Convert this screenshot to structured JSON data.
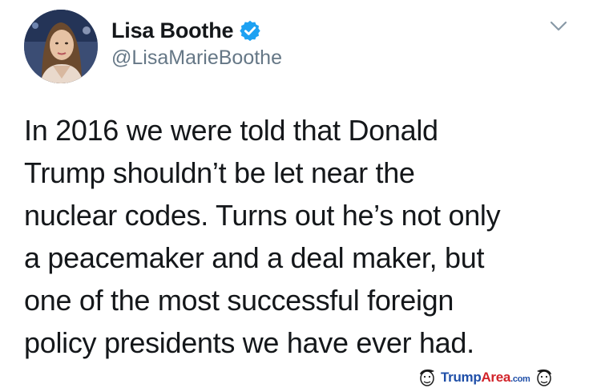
{
  "author": {
    "display_name": "Lisa Boothe",
    "handle": "@LisaMarieBoothe",
    "verified": true
  },
  "tweet": {
    "lines": [
      "In 2016 we were told that Donald",
      "Trump shouldn’t be let near the",
      "nuclear codes. Turns out he’s not only",
      "a peacemaker and a deal maker, but",
      "one of the most successful foreign",
      "policy presidents we have ever had."
    ]
  },
  "watermark": {
    "brand_part1": "Trump",
    "brand_part2": "Area",
    "brand_tld": ".com"
  },
  "colors": {
    "text": "#14171a",
    "handle": "#657786",
    "verified_badge": "#1da1f2",
    "watermark_blue": "#1f4fa8",
    "watermark_red": "#d2232a"
  },
  "icons": {
    "verified": "verified-badge-icon",
    "menu": "chevron-down-icon",
    "watermark_face": "trump-caricature-icon"
  }
}
